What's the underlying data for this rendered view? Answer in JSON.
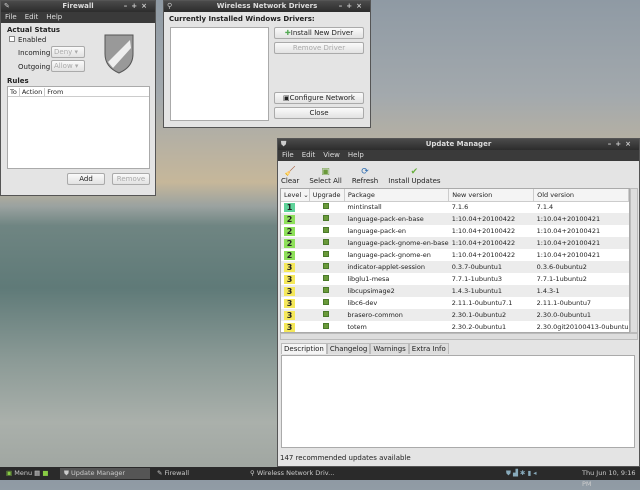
{
  "firewall": {
    "title": "Firewall",
    "menu": [
      "File",
      "Edit",
      "Help"
    ],
    "status_heading": "Actual Status",
    "enabled_label": "Enabled",
    "enabled": false,
    "incoming_label": "Incoming:",
    "incoming_value": "Deny",
    "outgoing_label": "Outgoing:",
    "outgoing_value": "Allow",
    "rules_heading": "Rules",
    "columns": [
      "To",
      "Action",
      "From"
    ],
    "add": "Add",
    "remove": "Remove"
  },
  "wireless": {
    "title": "Wireless Network Drivers",
    "heading": "Currently Installed Windows Drivers:",
    "install": "Install New Driver",
    "remove": "Remove Driver",
    "configure": "Configure Network",
    "close": "Close"
  },
  "update": {
    "title": "Update Manager",
    "menu": [
      "File",
      "Edit",
      "View",
      "Help"
    ],
    "toolbar": [
      "Clear",
      "Select All",
      "Refresh",
      "Install Updates"
    ],
    "columns": [
      "Level",
      "Upgrade",
      "Package",
      "New version",
      "Old version"
    ],
    "rows": [
      {
        "level": "1",
        "package": "mintinstall",
        "new": "7.1.6",
        "old": "7.1.4"
      },
      {
        "level": "2",
        "package": "language-pack-en-base",
        "new": "1:10.04+20100422",
        "old": "1:10.04+20100421"
      },
      {
        "level": "2",
        "package": "language-pack-en",
        "new": "1:10.04+20100422",
        "old": "1:10.04+20100421"
      },
      {
        "level": "2",
        "package": "language-pack-gnome-en-base",
        "new": "1:10.04+20100422",
        "old": "1:10.04+20100421"
      },
      {
        "level": "2",
        "package": "language-pack-gnome-en",
        "new": "1:10.04+20100422",
        "old": "1:10.04+20100421"
      },
      {
        "level": "3",
        "package": "indicator-applet-session",
        "new": "0.3.7-0ubuntu1",
        "old": "0.3.6-0ubuntu2"
      },
      {
        "level": "3",
        "package": "libglu1-mesa",
        "new": "7.7.1-1ubuntu3",
        "old": "7.7.1-1ubuntu2"
      },
      {
        "level": "3",
        "package": "libcupsimage2",
        "new": "1.4.3-1ubuntu1",
        "old": "1.4.3-1"
      },
      {
        "level": "3",
        "package": "libc6-dev",
        "new": "2.11.1-0ubuntu7.1",
        "old": "2.11.1-0ubuntu7"
      },
      {
        "level": "3",
        "package": "brasero-common",
        "new": "2.30.1-0ubuntu2",
        "old": "2.30.0-0ubuntu1"
      },
      {
        "level": "3",
        "package": "totem",
        "new": "2.30.2-0ubuntu1",
        "old": "2.30.0git20100413-0ubuntu"
      }
    ],
    "level_colors": {
      "1": "#5fd39a",
      "2": "#8ee05a",
      "3": "#f5e85a"
    },
    "tabs": [
      "Description",
      "Changelog",
      "Warnings",
      "Extra Info"
    ],
    "status": "147 recommended updates available"
  },
  "taskbar": {
    "menu": "Menu",
    "tasks": [
      "Update Manager",
      "Firewall",
      "Wireless Network Driv..."
    ],
    "clock": "Thu Jun 10,  9:16 PM"
  }
}
